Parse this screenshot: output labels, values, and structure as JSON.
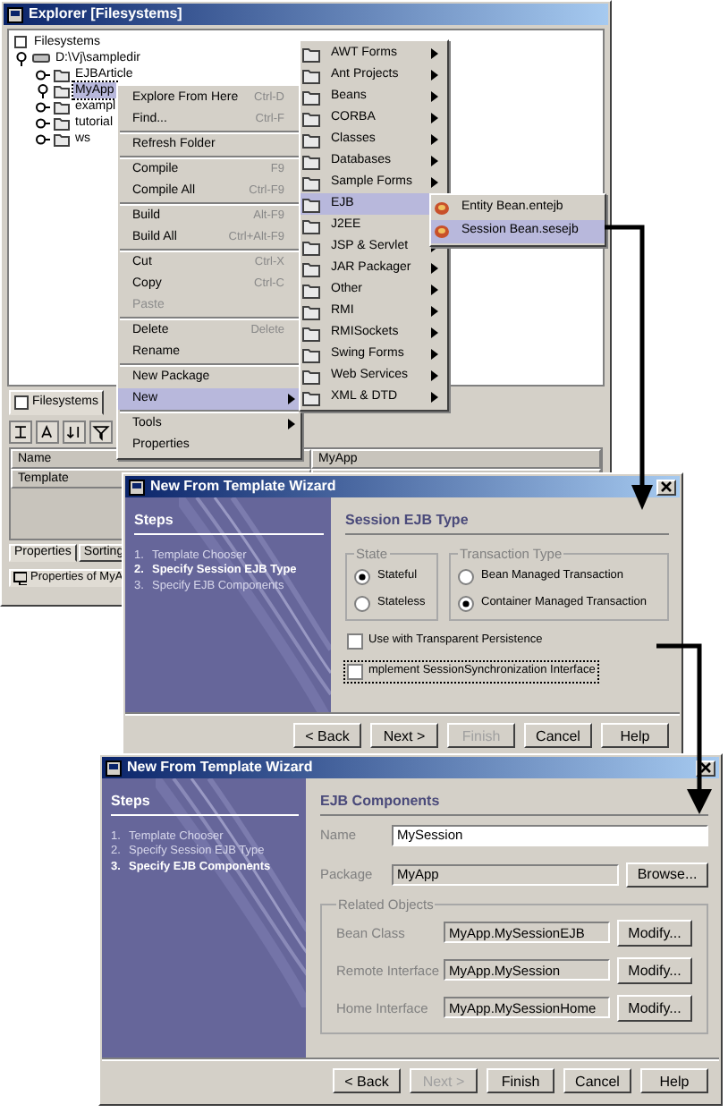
{
  "explorer": {
    "title": "Explorer [Filesystems]",
    "tree": [
      {
        "label": "Filesystems",
        "kind": "root",
        "children": [
          {
            "label": "D:\\Vj\\sampledir",
            "kind": "drive",
            "expanded": true,
            "selected": false,
            "children": [
              {
                "label": "EJBArticle",
                "kind": "folder",
                "expanded": false,
                "selected": false
              },
              {
                "label": "MyApp",
                "kind": "folder",
                "expanded": true,
                "selected": true
              },
              {
                "label": "exampl",
                "kind": "folder",
                "expanded": false,
                "selected": false
              },
              {
                "label": "tutorial",
                "kind": "folder",
                "expanded": false,
                "selected": false
              },
              {
                "label": "ws",
                "kind": "folder",
                "expanded": false,
                "selected": false
              }
            ]
          }
        ]
      }
    ],
    "tabs": [
      {
        "label": "Filesystems",
        "selected": true
      }
    ],
    "properties": {
      "columns": [
        "Name",
        "MyApp"
      ],
      "rows": [
        "Template"
      ],
      "tabs": [
        {
          "label": "Properties",
          "selected": true
        },
        {
          "label": "Sorting",
          "selected": false
        }
      ]
    },
    "bottom_tab": "Properties of MyA"
  },
  "context_menu": [
    {
      "kind": "item",
      "label": "Explore From Here",
      "shortcut": "Ctrl-D",
      "disabled": false,
      "selected": false,
      "submenu": false
    },
    {
      "kind": "item",
      "label": "Find...",
      "shortcut": "Ctrl-F",
      "disabled": false,
      "selected": false,
      "submenu": false
    },
    {
      "kind": "separator"
    },
    {
      "kind": "item",
      "label": "Refresh Folder",
      "disabled": false,
      "selected": false,
      "submenu": false
    },
    {
      "kind": "separator"
    },
    {
      "kind": "item",
      "label": "Compile",
      "shortcut": "F9",
      "disabled": false,
      "selected": false,
      "submenu": false
    },
    {
      "kind": "item",
      "label": "Compile All",
      "shortcut": "Ctrl-F9",
      "disabled": false,
      "selected": false,
      "submenu": false
    },
    {
      "kind": "separator"
    },
    {
      "kind": "item",
      "label": "Build",
      "shortcut": "Alt-F9",
      "disabled": false,
      "selected": false,
      "submenu": false
    },
    {
      "kind": "item",
      "label": "Build All",
      "shortcut": "Ctrl+Alt-F9",
      "disabled": false,
      "selected": false,
      "submenu": false
    },
    {
      "kind": "separator"
    },
    {
      "kind": "item",
      "label": "Cut",
      "shortcut": "Ctrl-X",
      "disabled": false,
      "selected": false,
      "submenu": false
    },
    {
      "kind": "item",
      "label": "Copy",
      "shortcut": "Ctrl-C",
      "disabled": false,
      "selected": false,
      "submenu": false
    },
    {
      "kind": "item",
      "label": "Paste",
      "disabled": true,
      "selected": false,
      "submenu": false
    },
    {
      "kind": "separator"
    },
    {
      "kind": "item",
      "label": "Delete",
      "shortcut": "Delete",
      "disabled": false,
      "selected": false,
      "submenu": false
    },
    {
      "kind": "item",
      "label": "Rename",
      "disabled": false,
      "selected": false,
      "submenu": false
    },
    {
      "kind": "separator"
    },
    {
      "kind": "item",
      "label": "New Package",
      "disabled": false,
      "selected": false,
      "submenu": false
    },
    {
      "kind": "item",
      "label": "New",
      "disabled": false,
      "selected": true,
      "submenu": true
    },
    {
      "kind": "separator"
    },
    {
      "kind": "item",
      "label": "Tools",
      "disabled": false,
      "selected": false,
      "submenu": true
    },
    {
      "kind": "item",
      "label": "Properties",
      "disabled": false,
      "selected": false,
      "submenu": false
    }
  ],
  "new_submenu": [
    {
      "label": "AWT Forms",
      "selected": false
    },
    {
      "label": "Ant Projects",
      "selected": false
    },
    {
      "label": "Beans",
      "selected": false
    },
    {
      "label": "CORBA",
      "selected": false
    },
    {
      "label": "Classes",
      "selected": false
    },
    {
      "label": "Databases",
      "selected": false
    },
    {
      "label": "Sample Forms",
      "selected": false
    },
    {
      "label": "EJB",
      "selected": true
    },
    {
      "label": "J2EE",
      "selected": false
    },
    {
      "label": "JSP & Servlet",
      "selected": false
    },
    {
      "label": "JAR Packager",
      "selected": false
    },
    {
      "label": "Other",
      "selected": false
    },
    {
      "label": "RMI",
      "selected": false
    },
    {
      "label": "RMISockets",
      "selected": false
    },
    {
      "label": "Swing Forms",
      "selected": false
    },
    {
      "label": "Web Services",
      "selected": false
    },
    {
      "label": "XML & DTD",
      "selected": false
    }
  ],
  "ejb_submenu": [
    {
      "label": "Entity Bean.entejb",
      "selected": false
    },
    {
      "label": "Session Bean.sesejb",
      "selected": true
    }
  ],
  "wizards": [
    {
      "title": "New From Template Wizard",
      "steps_heading": "Steps",
      "steps": [
        {
          "number": "1.",
          "label": "Template Chooser",
          "selected": false
        },
        {
          "number": "2.",
          "label": "Specify Session EJB Type",
          "selected": true
        },
        {
          "number": "3.",
          "label": "Specify EJB Components",
          "selected": false
        }
      ],
      "page": {
        "kind": "type",
        "heading": "Session EJB Type",
        "groups": [
          {
            "title": "State",
            "options": [
              {
                "label": "Stateful",
                "selected": true
              },
              {
                "label": "Stateless",
                "selected": false
              }
            ]
          },
          {
            "title": "Transaction Type",
            "options": [
              {
                "label": "Bean Managed Transaction",
                "selected": false
              },
              {
                "label": "Container Managed Transaction",
                "selected": true
              }
            ]
          }
        ],
        "checkboxes": [
          {
            "label": "Use with Transparent Persistence",
            "checked": false,
            "focused": false
          },
          {
            "label": "mplement SessionSynchronization Interface",
            "checked": false,
            "focused": true
          }
        ]
      },
      "buttons": [
        {
          "label": "< Back",
          "disabled": false
        },
        {
          "label": "Next >",
          "disabled": false
        },
        {
          "label": "Finish",
          "disabled": true
        },
        {
          "label": "Cancel",
          "disabled": false
        },
        {
          "label": "Help",
          "disabled": false
        }
      ]
    },
    {
      "title": "New From Template Wizard",
      "steps_heading": "Steps",
      "steps": [
        {
          "number": "1.",
          "label": "Template Chooser",
          "selected": false
        },
        {
          "number": "2.",
          "label": "Specify Session EJB Type",
          "selected": false
        },
        {
          "number": "3.",
          "label": "Specify EJB Components",
          "selected": true
        }
      ],
      "page": {
        "kind": "components",
        "heading": "EJB Components",
        "fields": [
          {
            "label": "Name",
            "value": "MySession",
            "editable": true
          },
          {
            "label": "Package",
            "value": "MyApp",
            "editable": false,
            "button": "Browse..."
          }
        ],
        "related": {
          "title": "Related Objects",
          "rows": [
            {
              "label": "Bean Class",
              "value": "MyApp.MySessionEJB",
              "button": "Modify..."
            },
            {
              "label": "Remote Interface",
              "value": "MyApp.MySession",
              "button": "Modify..."
            },
            {
              "label": "Home Interface",
              "value": "MyApp.MySessionHome",
              "button": "Modify..."
            }
          ]
        }
      },
      "buttons": [
        {
          "label": "< Back",
          "disabled": false
        },
        {
          "label": "Next >",
          "disabled": true
        },
        {
          "label": "Finish",
          "disabled": false
        },
        {
          "label": "Cancel",
          "disabled": false
        },
        {
          "label": "Help",
          "disabled": false
        }
      ]
    }
  ]
}
